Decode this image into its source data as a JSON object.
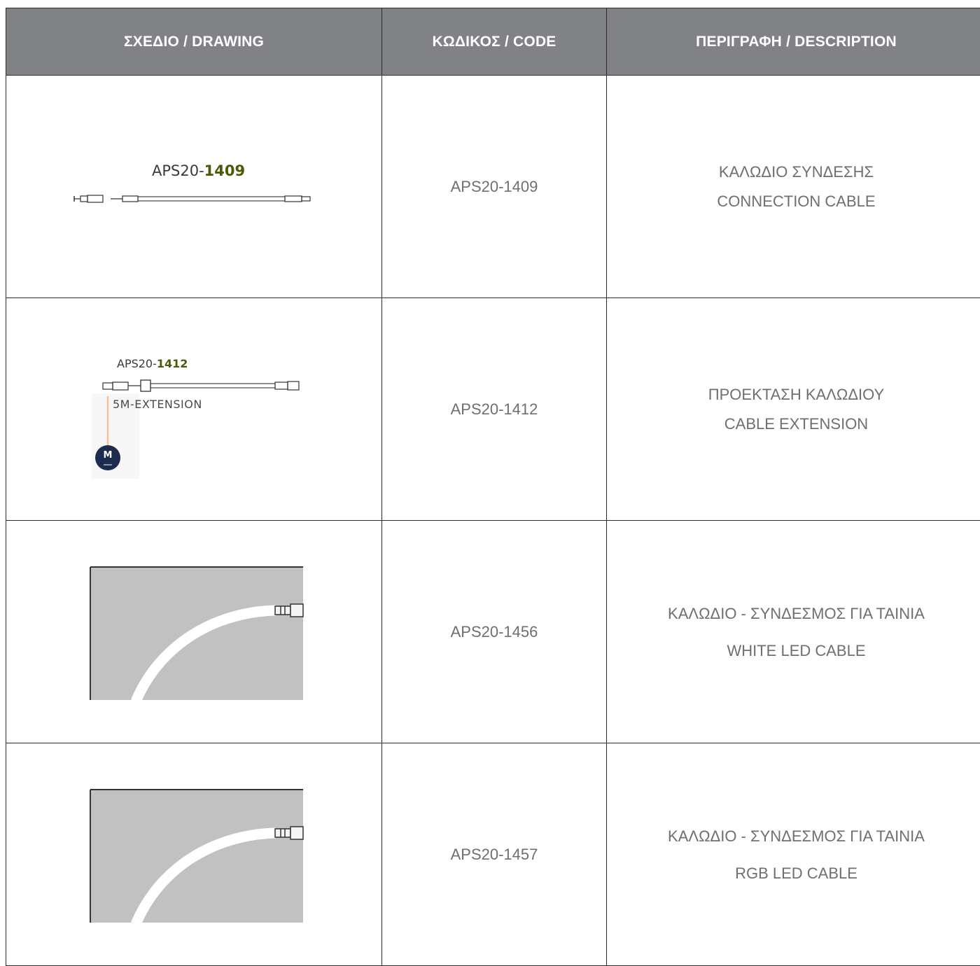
{
  "header": {
    "col_drawing": "ΣΧΕΔΙΟ / DRAWING",
    "col_code": "ΚΩΔΙΚΟΣ / CODE",
    "col_description": "ΠΕΡΙΓΡΑΦΗ / DESCRIPTION",
    "background_color": "#818285"
  },
  "rows": [
    {
      "drawing_label_prefix": "APS20-",
      "drawing_label_number": "1409",
      "code": "APS20-1409",
      "desc_gr": "ΚΑΛΩΔΙΟ ΣΥΝΔΕΣΗΣ",
      "desc_en": "CONNECTION CABLE"
    },
    {
      "drawing_label_prefix": "APS20-",
      "drawing_label_number": "1412",
      "drawing_sublabel": "5M-EXTENSION",
      "drawing_badge": "M",
      "code": "APS20-1412",
      "desc_gr": "ΠΡΟΕΚΤΑΣΗ ΚΑΛΩΔΙΟΥ",
      "desc_en": "CABLE EXTENSION"
    },
    {
      "code": "APS20-1456",
      "desc_gr": "ΚΑΛΩΔΙΟ - ΣΥΝΔΕΣΜΟΣ ΓΙΑ ΤΑΙΝΙΑ",
      "desc_en": "WHITE LED CABLE"
    },
    {
      "code": "APS20-1457",
      "desc_gr": "ΚΑΛΩΔΙΟ - ΣΥΝΔΕΣΜΟΣ ΓΙΑ ΤΑΙΝΙΑ",
      "desc_en": "RGB LED CABLE"
    }
  ]
}
